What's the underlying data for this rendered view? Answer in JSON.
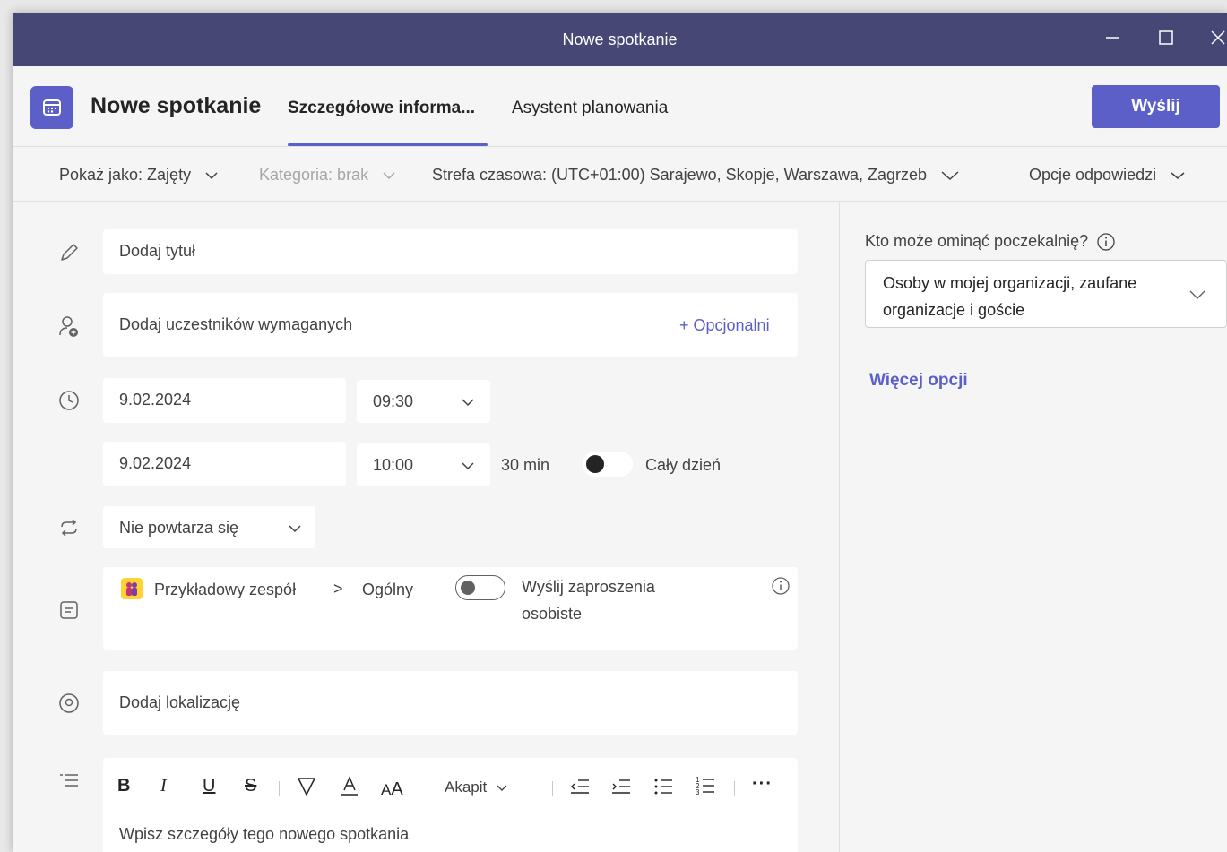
{
  "window": {
    "title": "Nowe spotkanie"
  },
  "header": {
    "title": "Nowe spotkanie",
    "tabs": [
      {
        "label": "Szczegółowe informa...",
        "active": true
      },
      {
        "label": "Asystent planowania",
        "active": false
      }
    ],
    "send_label": "Wyślij"
  },
  "options": {
    "show_as": "Pokaż jako: Zajęty",
    "category": "Kategoria: brak",
    "timezone": "Strefa czasowa: (UTC+01:00) Sarajewo, Skopje, Warszawa, Zagrzeb",
    "response_options": "Opcje odpowiedzi"
  },
  "form": {
    "title_placeholder": "Dodaj tytuł",
    "attendees_placeholder": "Dodaj uczestników wymaganych",
    "optional_link": "+ Opcjonalni",
    "start_date": "9.02.2024",
    "start_time": "09:30",
    "end_date": "9.02.2024",
    "end_time": "10:00",
    "duration": "30 min",
    "all_day_label": "Cały dzień",
    "all_day": false,
    "repeat": "Nie powtarza się",
    "channel": {
      "team": "Przykładowy zespół",
      "separator": ">",
      "name": "Ogólny",
      "invite_label_line1": "Wyślij zaproszenia",
      "invite_label_line2": "osobiste",
      "invite_enabled": false
    },
    "location_placeholder": "Dodaj lokalizację",
    "editor": {
      "paragraph_label": "Akapit",
      "body_placeholder": "Wpisz szczegóły tego nowego spotkania"
    }
  },
  "side": {
    "lobby_label": "Kto może ominąć poczekalnię?",
    "lobby_line1": "Osoby w mojej organizacji, zaufane",
    "lobby_line2": "organizacje i goście",
    "more_options": "Więcej opcji"
  },
  "colors": {
    "titlebar": "#464775",
    "accent": "#5b5fc7",
    "background": "#f5f5f5"
  }
}
